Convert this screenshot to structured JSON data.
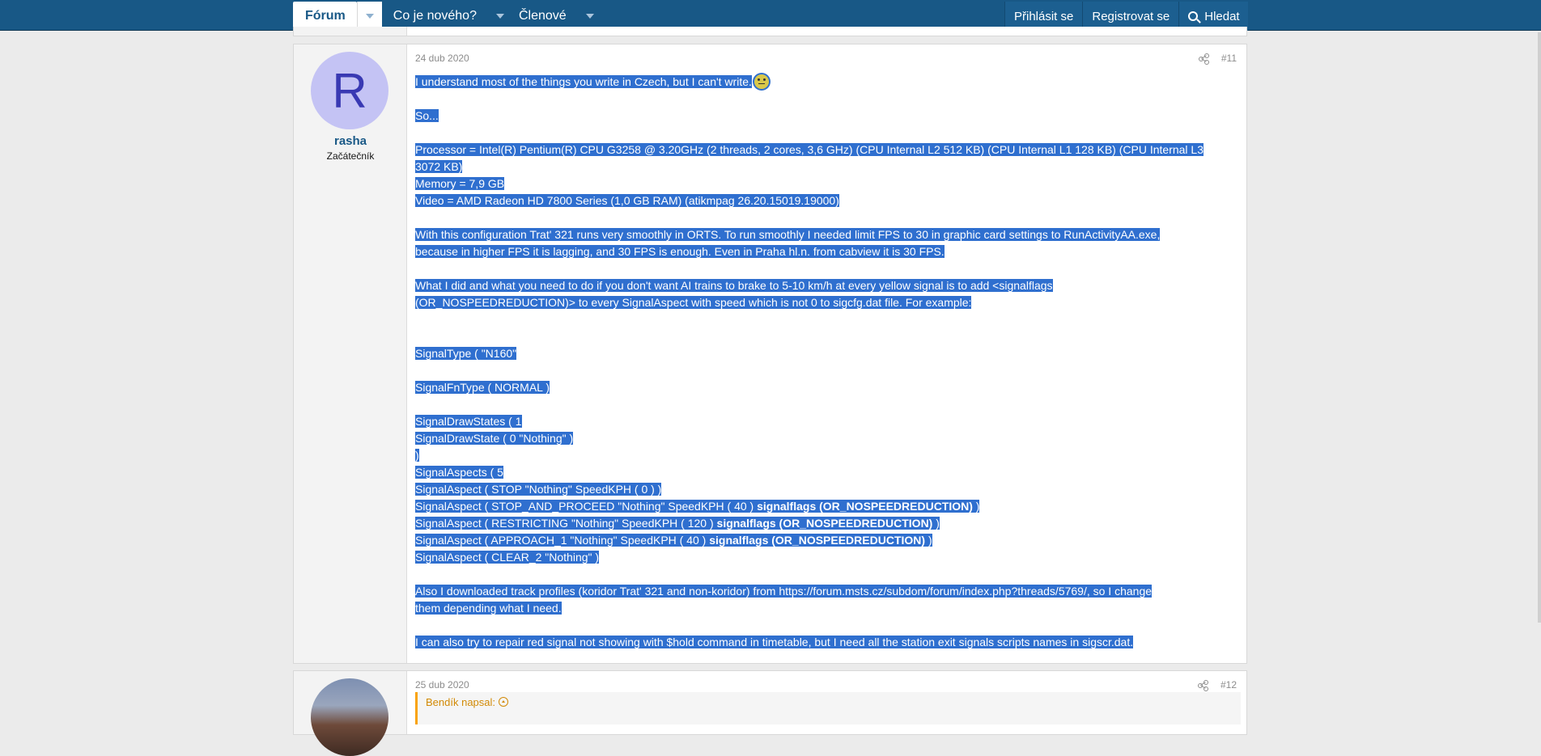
{
  "nav": {
    "forum": "Fórum",
    "whats_new": "Co je nového?",
    "members": "Členové",
    "login": "Přihlásit se",
    "register": "Registrovat se",
    "search": "Hledat"
  },
  "post11": {
    "date": "24 dub 2020",
    "number": "#11",
    "user": {
      "initial": "R",
      "name": "rasha",
      "title": "Začátečník",
      "avatar_color": "#c4c3f4"
    },
    "lines": {
      "l01": "I understand most of the things you write in Czech, but I can't write.",
      "l02": "So...",
      "l03": "Processor = Intel(R) Pentium(R) CPU G3258 @ 3.20GHz (2 threads, 2 cores, 3,6 GHz) (CPU Internal L2 512 KB) (CPU Internal L1 128 KB) (CPU Internal L3",
      "l04": "3072 KB)",
      "l05": "Memory = 7,9 GB",
      "l06": "Video = AMD Radeon HD 7800 Series (1,0 GB RAM) (atikmpag 26.20.15019.19000)",
      "l07": "With this configuration Trat' 321 runs very smoothly in ORTS. To run smoothly I needed limit FPS to 30 in graphic card settings to RunActivityAA.exe,",
      "l08": "because in higher FPS it is lagging, and 30 FPS is enough. Even in Praha hl.n. from cabview it is 30 FPS.",
      "l09": "What I did and what you need to do if you don't want AI trains to brake to 5-10 km/h at every yellow signal is to add <signalflags",
      "l10": "(OR_NOSPEEDREDUCTION)> to every SignalAspect with speed which is not 0 to sigcfg.dat file. For example:",
      "l11": "SignalType ( \"N160\"",
      "l12": "SignalFnType ( NORMAL )",
      "l13": "SignalDrawStates ( 1",
      "l14": "SignalDrawState ( 0 \"Nothing\" )",
      "l15": ")",
      "l16": "SignalAspects ( 5",
      "l17": "SignalAspect ( STOP \"Nothing\" SpeedKPH ( 0 ) )",
      "l18a": "SignalAspect ( STOP_AND_PROCEED \"Nothing\" SpeedKPH ( 40 ) ",
      "l19a": "SignalAspect ( RESTRICTING \"Nothing\" SpeedKPH ( 120 ) ",
      "l20a": "SignalAspect ( APPROACH_1 \"Nothing\" SpeedKPH ( 40 ) ",
      "flag": "signalflags (OR_NOSPEEDREDUCTION)",
      "close": " )",
      "l21": "SignalAspect ( CLEAR_2 \"Nothing\" )",
      "l22": "Also I downloaded track profiles (koridor Trat' 321 and non-koridor) from https://forum.msts.cz/subdom/forum/index.php?threads/5769/, so I change",
      "l23": "them depending what I need.",
      "l24": "I can also try to repair red signal not showing with $hold command in timetable, but I need all the station exit signals scripts names in sigscr.dat."
    },
    "emoji": "unamused-emoji"
  },
  "post12": {
    "date": "25 dub 2020",
    "number": "#12",
    "quote_author": "Bendík napsal:"
  }
}
